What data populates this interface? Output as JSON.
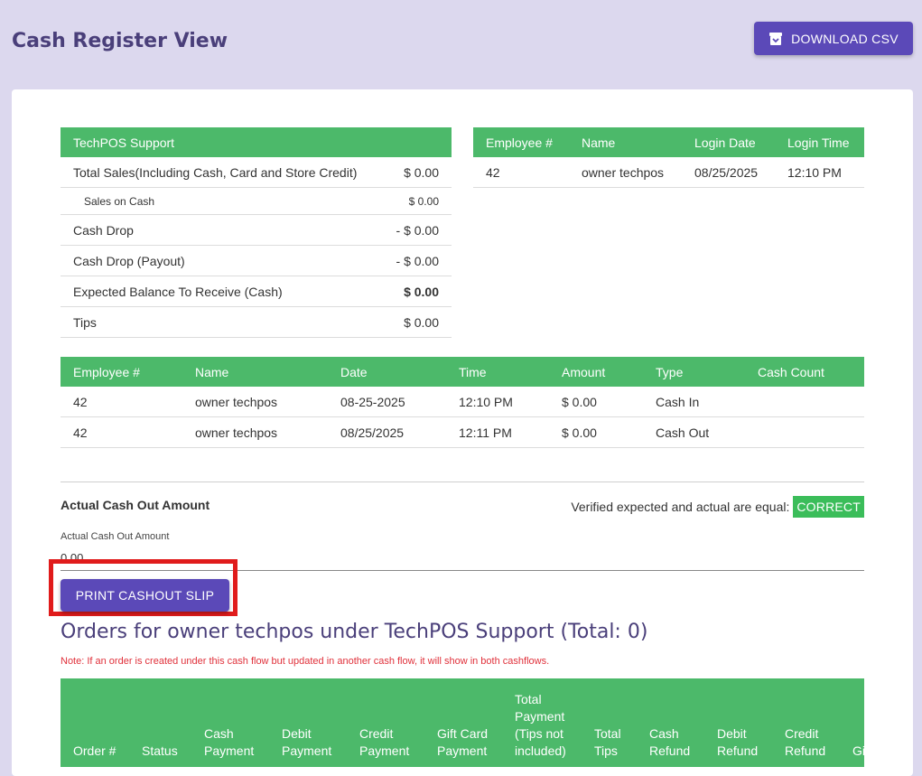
{
  "page": {
    "title": "Cash Register View",
    "download_label": "DOWNLOAD CSV"
  },
  "summary": {
    "header": "TechPOS Support",
    "rows": [
      {
        "label": "Total Sales(Including Cash, Card and Store Credit)",
        "amount": "$ 0.00"
      },
      {
        "label": "Sales on Cash",
        "amount": "$ 0.00"
      },
      {
        "label": "Cash Drop",
        "amount": "- $ 0.00"
      },
      {
        "label": "Cash Drop (Payout)",
        "amount": "- $ 0.00"
      },
      {
        "label": "Expected Balance To Receive (Cash)",
        "amount": "$ 0.00"
      },
      {
        "label": "Tips",
        "amount": "$ 0.00"
      }
    ]
  },
  "employee_table": {
    "headers": [
      "Employee #",
      "Name",
      "Login Date",
      "Login Time"
    ],
    "rows": [
      [
        "42",
        "owner techpos",
        "08/25/2025",
        "12:10 PM"
      ]
    ]
  },
  "cash_flow_table": {
    "headers": [
      "Employee #",
      "Name",
      "Date",
      "Time",
      "Amount",
      "Type",
      "Cash Count"
    ],
    "rows": [
      [
        "42",
        "owner techpos",
        "08-25-2025",
        "12:10 PM",
        "$ 0.00",
        "Cash In",
        ""
      ],
      [
        "42",
        "owner techpos",
        "08/25/2025",
        "12:11 PM",
        "$ 0.00",
        "Cash Out",
        ""
      ]
    ]
  },
  "actual_cash": {
    "title": "Actual Cash Out Amount",
    "verified_text": "Verified expected and actual are equal:",
    "verified_badge": "CORRECT",
    "field_label": "Actual Cash Out Amount",
    "field_value": "0.00",
    "print_label": "PRINT CASHOUT SLIP"
  },
  "orders": {
    "title": "Orders for owner techpos under TechPOS Support (Total: 0)",
    "note": "Note: If an order is created under this cash flow but updated in another cash flow, it will show in both cashflows.",
    "headers": [
      "Order #",
      "Status",
      "Cash Payment",
      "Debit Payment",
      "Credit Payment",
      "Gift Card Payment",
      "Total Payment (Tips not included)",
      "Total Tips",
      "Cash Refund",
      "Debit Refund",
      "Credit Refund",
      "Gift Card Refund"
    ]
  }
}
